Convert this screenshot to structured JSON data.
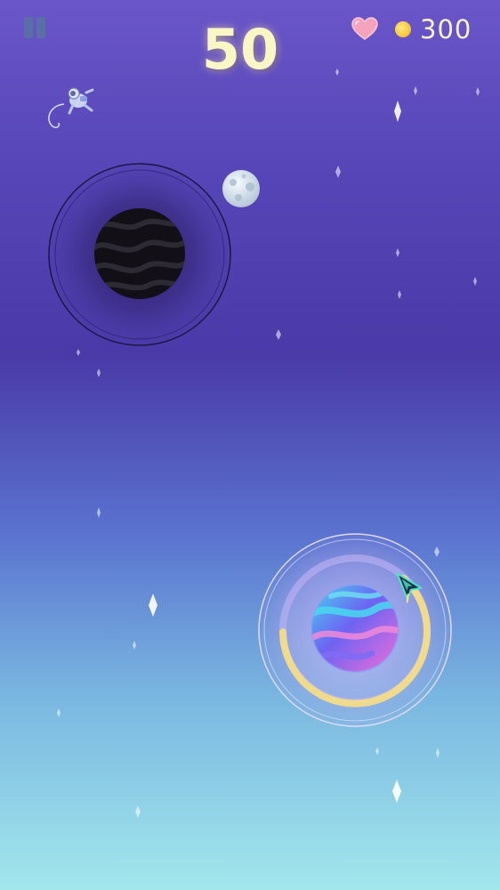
{
  "hud": {
    "score": "50",
    "coins": "300",
    "pause_icon": "pause-icon",
    "lives_icon": "heart-icon",
    "coin_icon": "coin-icon"
  },
  "colors": {
    "score_text": "#fbf6c6",
    "coin": "#f7c93a",
    "heart": "#f4a3bd",
    "orbit_progress": "#f2dc88"
  }
}
